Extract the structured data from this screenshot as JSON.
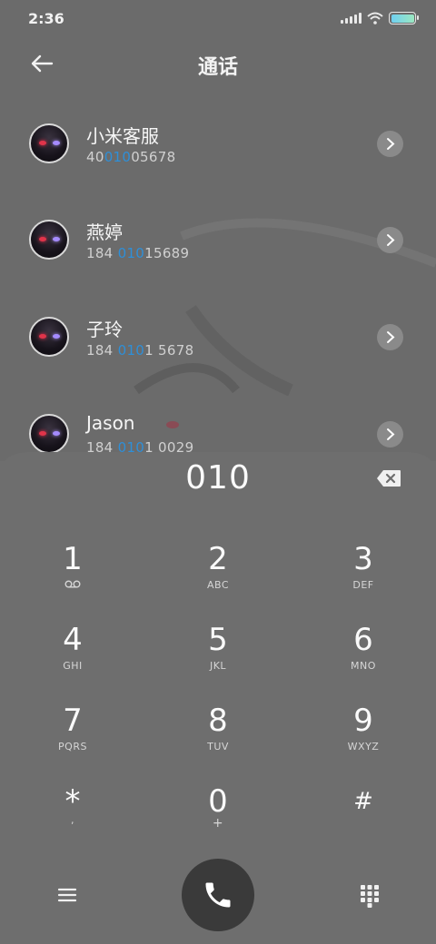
{
  "status": {
    "time": "2:36"
  },
  "header": {
    "title": "通话"
  },
  "contacts": [
    {
      "name": "小米客服",
      "num_pre": "40",
      "num_hl": "010",
      "num_post": "05678"
    },
    {
      "name": "燕婷",
      "num_pre": "184 ",
      "num_hl": "010",
      "num_post": "15689"
    },
    {
      "name": "子玲",
      "num_pre": "184 ",
      "num_hl": "010",
      "num_post": "1 5678"
    },
    {
      "name": "Jason",
      "num_pre": "184 ",
      "num_hl": "010",
      "num_post": "1 0029"
    }
  ],
  "dialer": {
    "entered": "010",
    "keys": [
      {
        "digit": "1",
        "sub": ""
      },
      {
        "digit": "2",
        "sub": "ABC"
      },
      {
        "digit": "3",
        "sub": "DEF"
      },
      {
        "digit": "4",
        "sub": "GHI"
      },
      {
        "digit": "5",
        "sub": "JKL"
      },
      {
        "digit": "6",
        "sub": "MNO"
      },
      {
        "digit": "7",
        "sub": "PQRS"
      },
      {
        "digit": "8",
        "sub": "TUV"
      },
      {
        "digit": "9",
        "sub": "WXYZ"
      },
      {
        "digit": "*",
        "sub": ","
      },
      {
        "digit": "0",
        "sub": "+"
      },
      {
        "digit": "#",
        "sub": ""
      }
    ]
  },
  "colors": {
    "background": "#6b6b6b",
    "highlight": "#2e8fd8",
    "call_button": "#3a3a3a"
  },
  "icons": {
    "back": "arrow-left-icon",
    "voicemail": "voicemail-icon",
    "backspace": "backspace-icon",
    "menu": "hamburger-menu-icon",
    "call": "phone-icon",
    "keypad": "dialpad-icon"
  }
}
